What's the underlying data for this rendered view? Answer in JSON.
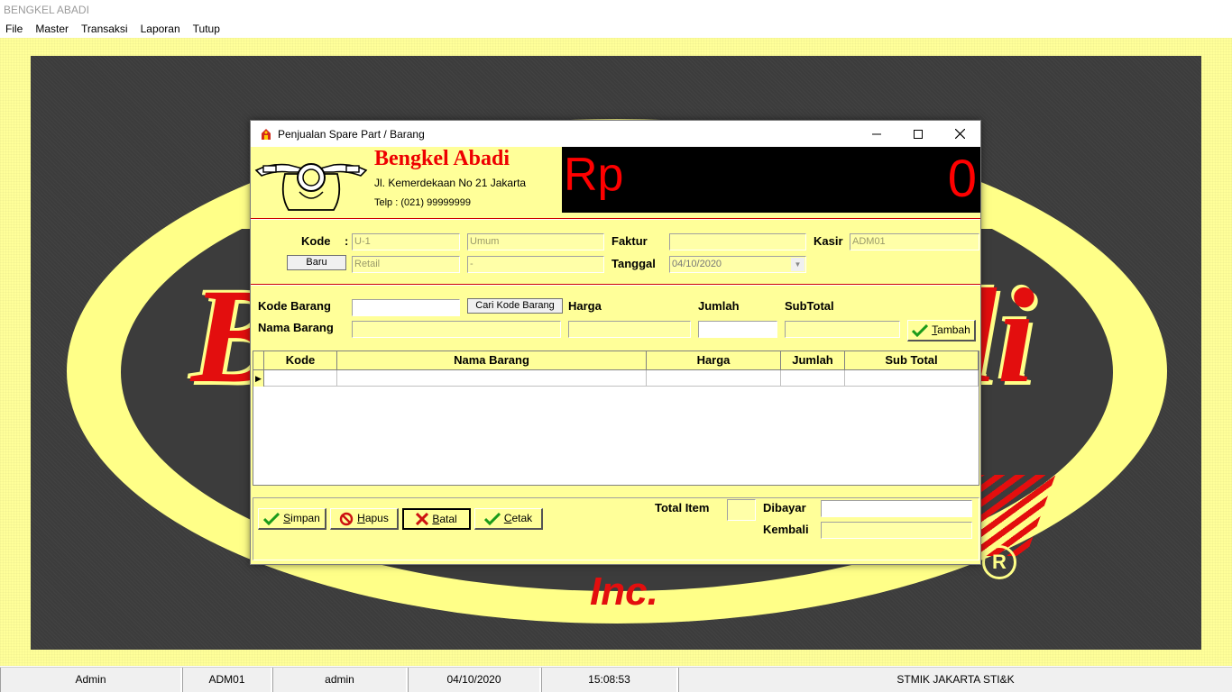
{
  "app": {
    "title": "BENGKEL ABADI",
    "menu": [
      "File",
      "Master",
      "Transaksi",
      "Laporan",
      "Tutup"
    ]
  },
  "dialog": {
    "title": "Penjualan Spare Part / Barang",
    "brand_name": "Bengkel Abadi",
    "brand_address": "Jl. Kemerdekaan No 21 Jakarta",
    "brand_phone": "Telp : (021) 99999999",
    "currency": "Rp",
    "total_display": "0",
    "customer": {
      "kode_label": "Kode",
      "colon": ":",
      "kode_value": "U-1",
      "nama_value": "Umum",
      "baru_button": "Baru",
      "tipe_value": "Retail",
      "extra_value": "-"
    },
    "faktur": {
      "label": "Faktur",
      "value": ""
    },
    "tanggal": {
      "label": "Tanggal",
      "value": "04/10/2020"
    },
    "kasir": {
      "label": "Kasir",
      "value": "ADM01"
    },
    "item": {
      "kode_barang_label": "Kode Barang",
      "cari_button": "Cari Kode Barang",
      "nama_barang_label": "Nama Barang",
      "harga_label": "Harga",
      "jumlah_label": "Jumlah",
      "subtotal_label": "SubTotal",
      "tambah_button_prefix": "",
      "tambah_button_u": "T",
      "tambah_button_rest": "ambah"
    },
    "grid": {
      "columns": [
        "Kode",
        "Nama Barang",
        "Harga",
        "Jumlah",
        "Sub Total"
      ]
    },
    "buttons": {
      "simpan_u": "S",
      "simpan_rest": "impan",
      "hapus_u": "H",
      "hapus_rest": "apus",
      "batal_u": "B",
      "batal_rest": "atal",
      "cetak_u": "C",
      "cetak_rest": "etak"
    },
    "summary": {
      "total_item_label": "Total Item",
      "dibayar_label": "Dibayar",
      "kembali_label": "Kembali"
    }
  },
  "statusbar": [
    "Admin",
    "ADM01",
    "admin",
    "04/10/2020",
    "15:08:53",
    "STMIK JAKARTA STI&K"
  ]
}
